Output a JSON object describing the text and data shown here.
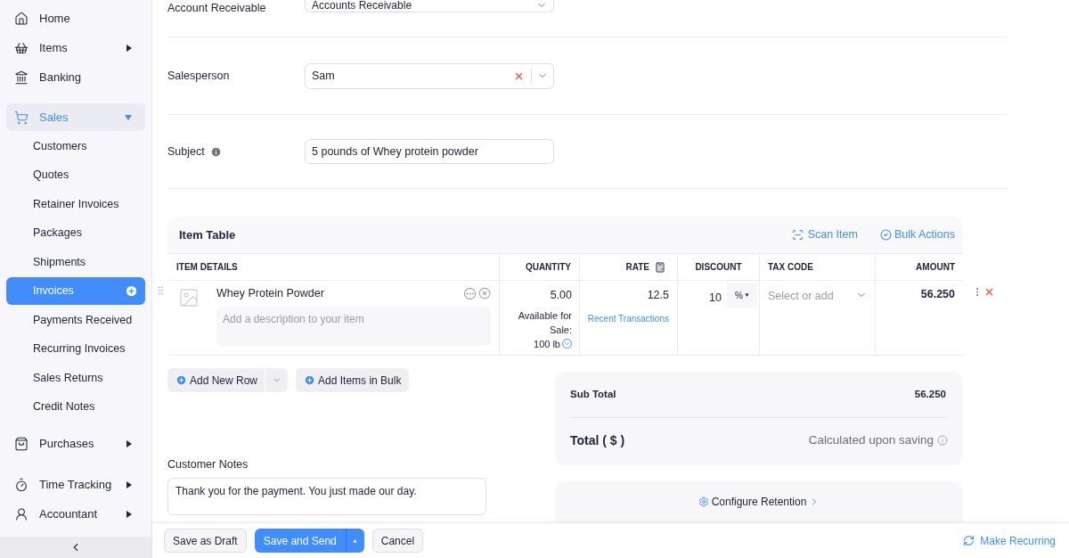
{
  "sidebar": {
    "items": [
      {
        "label": "Home",
        "selected": false
      },
      {
        "label": "Items",
        "selected": false,
        "expanded": false
      },
      {
        "label": "Banking",
        "selected": false
      },
      {
        "label": "Sales",
        "selected": true,
        "expanded": true,
        "children": [
          {
            "label": "Customers",
            "selected": false
          },
          {
            "label": "Quotes",
            "selected": false
          },
          {
            "label": "Retainer Invoices",
            "selected": false
          },
          {
            "label": "Packages",
            "selected": false
          },
          {
            "label": "Shipments",
            "selected": false
          },
          {
            "label": "Invoices",
            "selected": true
          },
          {
            "label": "Payments Received",
            "selected": false
          },
          {
            "label": "Recurring Invoices",
            "selected": false
          },
          {
            "label": "Sales Returns",
            "selected": false
          },
          {
            "label": "Credit Notes",
            "selected": false
          }
        ]
      },
      {
        "label": "Purchases",
        "selected": false,
        "expanded": false
      },
      {
        "label": "Time Tracking",
        "selected": false,
        "expanded": false
      },
      {
        "label": "Accountant",
        "selected": false,
        "expanded": false
      }
    ]
  },
  "form": {
    "account": {
      "label": "Account Receivable",
      "value": "Accounts Receivable"
    },
    "salesperson": {
      "label": "Salesperson",
      "value": "Sam"
    },
    "subject": {
      "label": "Subject",
      "value": "5 pounds of Whey protein powder"
    }
  },
  "item_table": {
    "title": "Item Table",
    "actions": [
      "Scan Item",
      "Bulk Actions"
    ],
    "columns": [
      "ITEM DETAILS",
      "QUANTITY",
      "RATE",
      "DISCOUNT",
      "TAX CODE",
      "AMOUNT"
    ],
    "rows": [
      {
        "name": "Whey Protein Powder",
        "description_placeholder": "Add a description to your item",
        "quantity": "5.00",
        "availability": "Available for Sale:",
        "stock": "100 lb",
        "rate": "12.5",
        "rate_link": "Recent Transactions",
        "discount": "10",
        "discount_unit": "%",
        "tax_placeholder": "Select or add",
        "amount": "56.250"
      }
    ],
    "buttons": [
      "Add New Row",
      "Add Items in Bulk"
    ]
  },
  "totals": {
    "sub_total_label": "Sub Total",
    "sub_total": "56.250",
    "total_label": "Total ( $ )",
    "total_value": "Calculated upon saving"
  },
  "retention": "Configure Retention",
  "customer_notes": {
    "label": "Customer Notes",
    "value": "Thank you for the payment. You just made our day."
  },
  "footer": {
    "buttons": [
      "Save as Draft",
      "Save and Send",
      "Cancel"
    ],
    "recurring": "Make Recurring"
  }
}
